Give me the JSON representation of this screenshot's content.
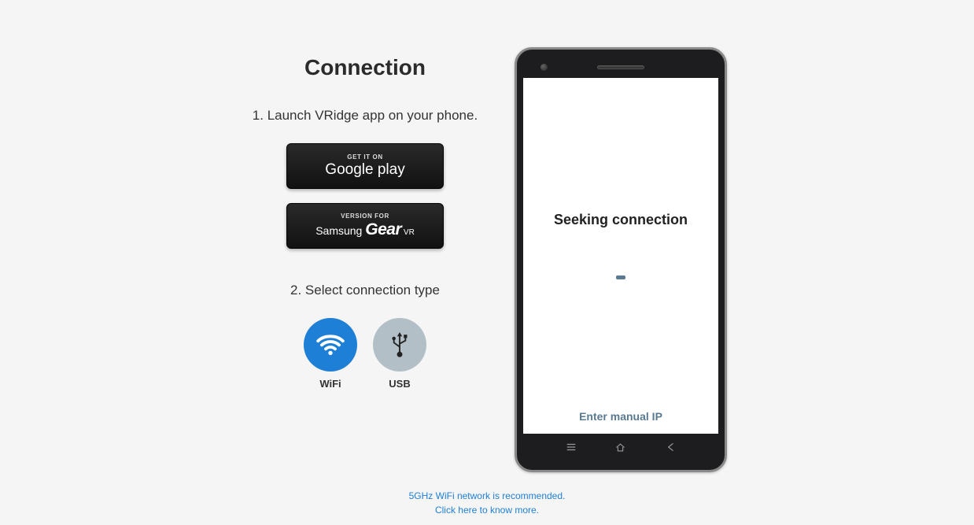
{
  "title": "Connection",
  "step1": "1. Launch VRidge app on your phone.",
  "googleplay": {
    "top": "GET IT ON",
    "name_1": "Google ",
    "name_2": "play"
  },
  "gearvr": {
    "top": "VERSION FOR",
    "name_1": "Samsung ",
    "name_2": "Gear",
    "name_3": " VR"
  },
  "step2": "2. Select connection type",
  "conn": {
    "wifi": "WiFi",
    "usb": "USB"
  },
  "phone": {
    "status": "Seeking connection",
    "manual_ip": "Enter manual IP"
  },
  "footer": {
    "line1": "5GHz WiFi network is recommended.",
    "line2": "Click here to know more."
  }
}
